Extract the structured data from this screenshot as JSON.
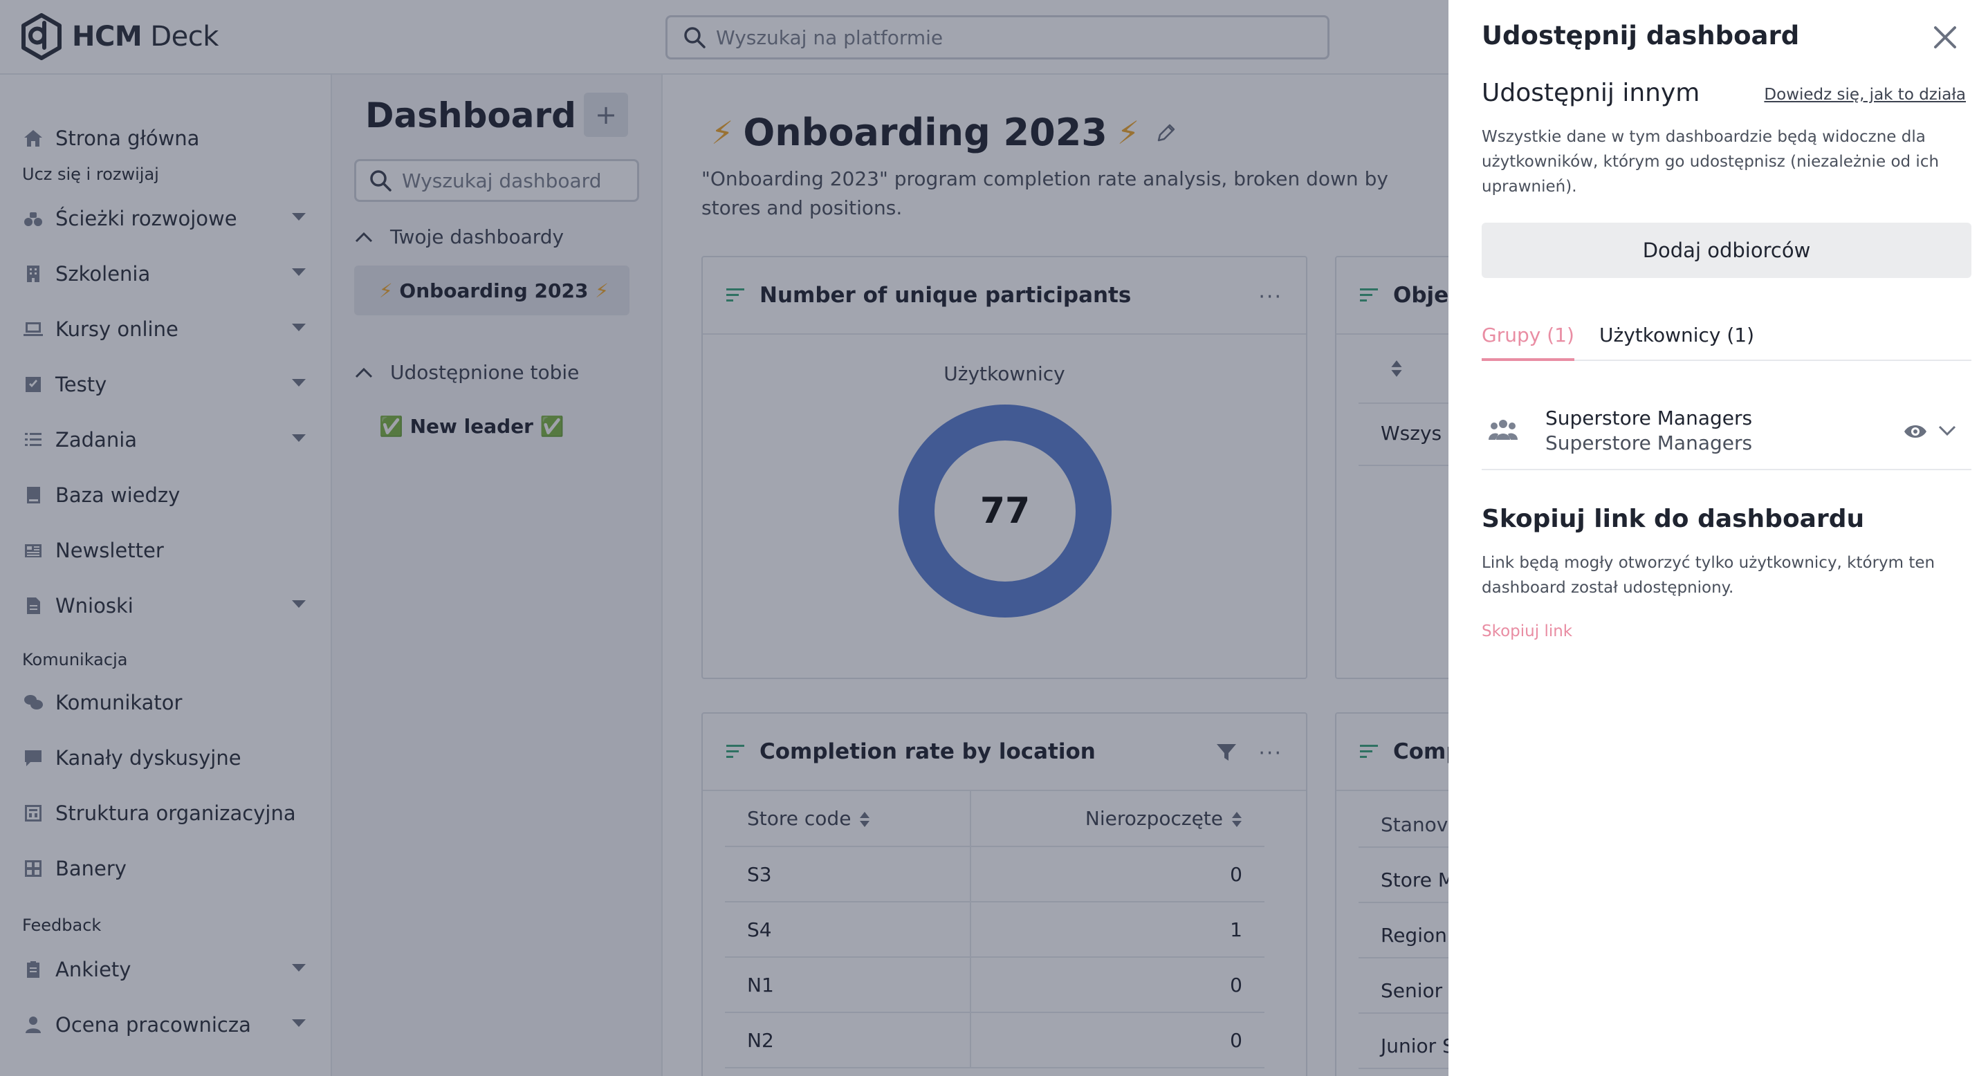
{
  "app": {
    "logo_text_bold": "HCM",
    "logo_text_light": " Deck",
    "search_placeholder": "Wyszukaj na platformie"
  },
  "sidebar": {
    "home": "Strona główna",
    "section_learn": "Ucz się i rozwijaj",
    "paths": "Ścieżki rozwojowe",
    "trainings": "Szkolenia",
    "courses": "Kursy online",
    "tests": "Testy",
    "tasks": "Zadania",
    "knowledge": "Baza wiedzy",
    "newsletter": "Newsletter",
    "requests": "Wnioski",
    "section_comm": "Komunikacja",
    "messenger": "Komunikator",
    "channels": "Kanały dyskusyjne",
    "org": "Struktura organizacyjna",
    "banners": "Banery",
    "section_feedback": "Feedback",
    "surveys": "Ankiety",
    "review": "Ocena pracownicza"
  },
  "dash_panel": {
    "title": "Dashboard",
    "add": "+",
    "search_placeholder": "Wyszukaj dashboard",
    "own_group": "Twoje dashboardy",
    "own_item": "Onboarding 2023",
    "shared_group": "Udostępnione tobie",
    "shared_item": "New leader",
    "bolt": "⚡",
    "check": "✅"
  },
  "main": {
    "title": "Onboarding 2023",
    "description": "\"Onboarding 2023\" program completion rate analysis, broken down by stores and positions.",
    "card_participants": {
      "title": "Number of unique participants",
      "more": "···",
      "label": "Użytkownicy",
      "value": "77"
    },
    "card_objectives_partial": {
      "title": "Obje",
      "row1": "Wszys"
    },
    "card_location": {
      "title": "Completion rate by location",
      "more": "···",
      "col1": "Store code",
      "col2": "Nierozpoczęte",
      "rows": [
        {
          "code": "S3",
          "value": "0"
        },
        {
          "code": "S4",
          "value": "1"
        },
        {
          "code": "N1",
          "value": "0"
        },
        {
          "code": "N2",
          "value": "0"
        }
      ]
    },
    "card_position_partial": {
      "title": "Comp",
      "col1": "Stanov",
      "rows": [
        "Store M",
        "Region",
        "Senior",
        "Junior S"
      ]
    }
  },
  "drawer": {
    "title": "Udostępnij dashboard",
    "share_heading": "Udostępnij innym",
    "learn_link": "Dowiedz się, jak to działa",
    "share_desc": "Wszystkie dane w tym dashboardzie będą widoczne dla użytkowników, którym go udostępnisz (niezależnie od ich uprawnień).",
    "add_button": "Dodaj odbiorców",
    "tab_groups": "Grupy (1)",
    "tab_users": "Użytkownicy (1)",
    "group_name": "Superstore Managers",
    "group_sub": "Superstore Managers",
    "copy_heading": "Skopiuj link do dashboardu",
    "copy_desc": "Link będą mogły otworzyć tylko użytkownicy, którym ten dashboard został udostępniony.",
    "copy_link": "Skopiuj link"
  },
  "colors": {
    "accent_pink": "#e98da3",
    "donut_blue": "#5b7fcf",
    "bolt_orange": "#f0a72c",
    "header_lines_green": "#3aa57a",
    "overlay": "rgba(33,40,64,0.42)"
  },
  "icons": {
    "logo": "hexagon-d-logo",
    "home": "home-icon",
    "close": "close-icon",
    "group": "users-group-icon",
    "eye": "eye-icon",
    "chevron": "chevron-down-icon"
  }
}
